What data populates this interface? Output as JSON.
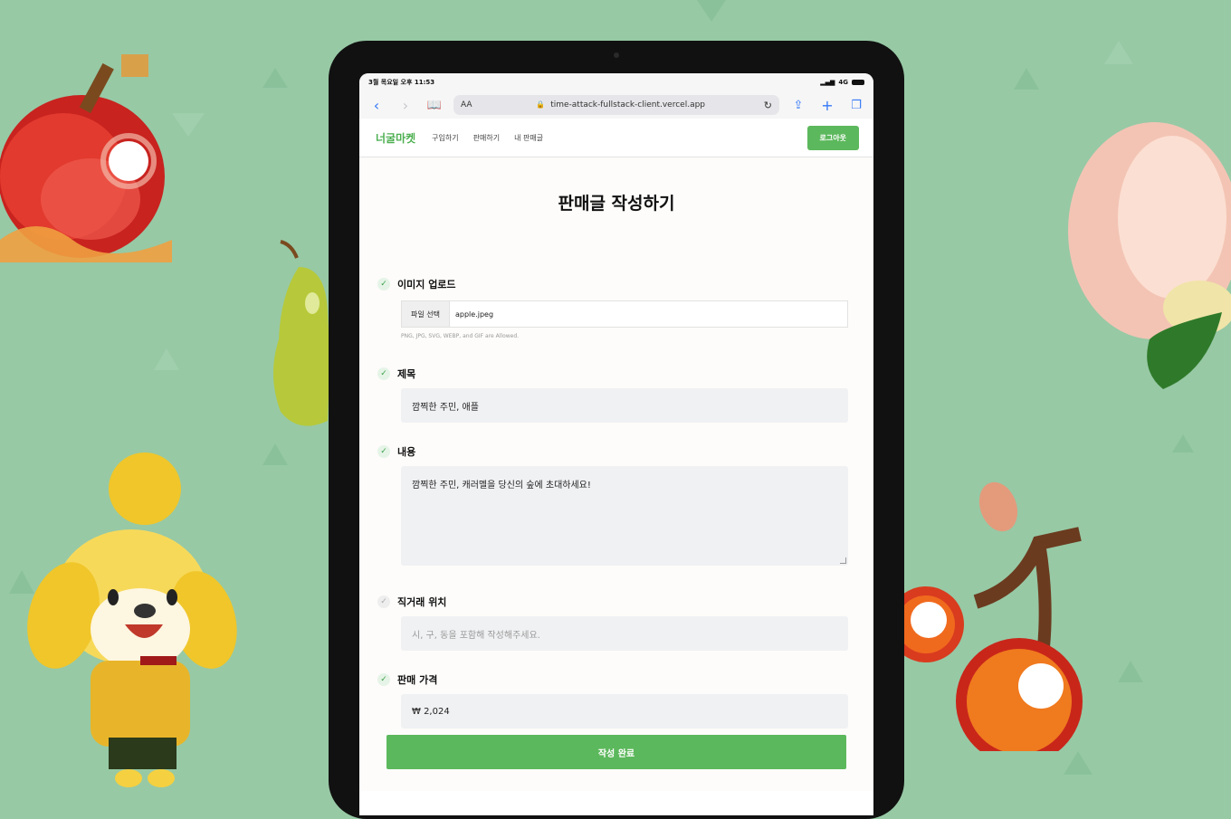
{
  "status": {
    "time": "3월 목요일 오후 11:53",
    "signal": "4G"
  },
  "browser": {
    "reader_label": "AA",
    "url": "time-attack-fullstack-client.vercel.app"
  },
  "site": {
    "logo": "너굴마켓",
    "nav": [
      "구입하기",
      "판매하기",
      "내 판매글"
    ],
    "logout": "로그아웃"
  },
  "form": {
    "title": "판매글 작성하기",
    "image": {
      "label": "이미지 업로드",
      "button": "파일 선택",
      "filename": "apple.jpeg",
      "hint": "PNG, JPG, SVG, WEBP, and GIF are Allowed."
    },
    "subject": {
      "label": "제목",
      "value": "깜찍한 주민, 애플"
    },
    "body": {
      "label": "내용",
      "value": "깜찍한 주민, 캐러멜을 당신의 숲에 초대하세요!"
    },
    "location": {
      "label": "직거래 위치",
      "placeholder": "시, 구, 동을 포함해 작성해주세요."
    },
    "price": {
      "label": "판매 가격",
      "value": "₩  2,024"
    },
    "submit": "작성 완료"
  },
  "colors": {
    "background": "#97c9a5",
    "accent": "#5cb85c"
  }
}
